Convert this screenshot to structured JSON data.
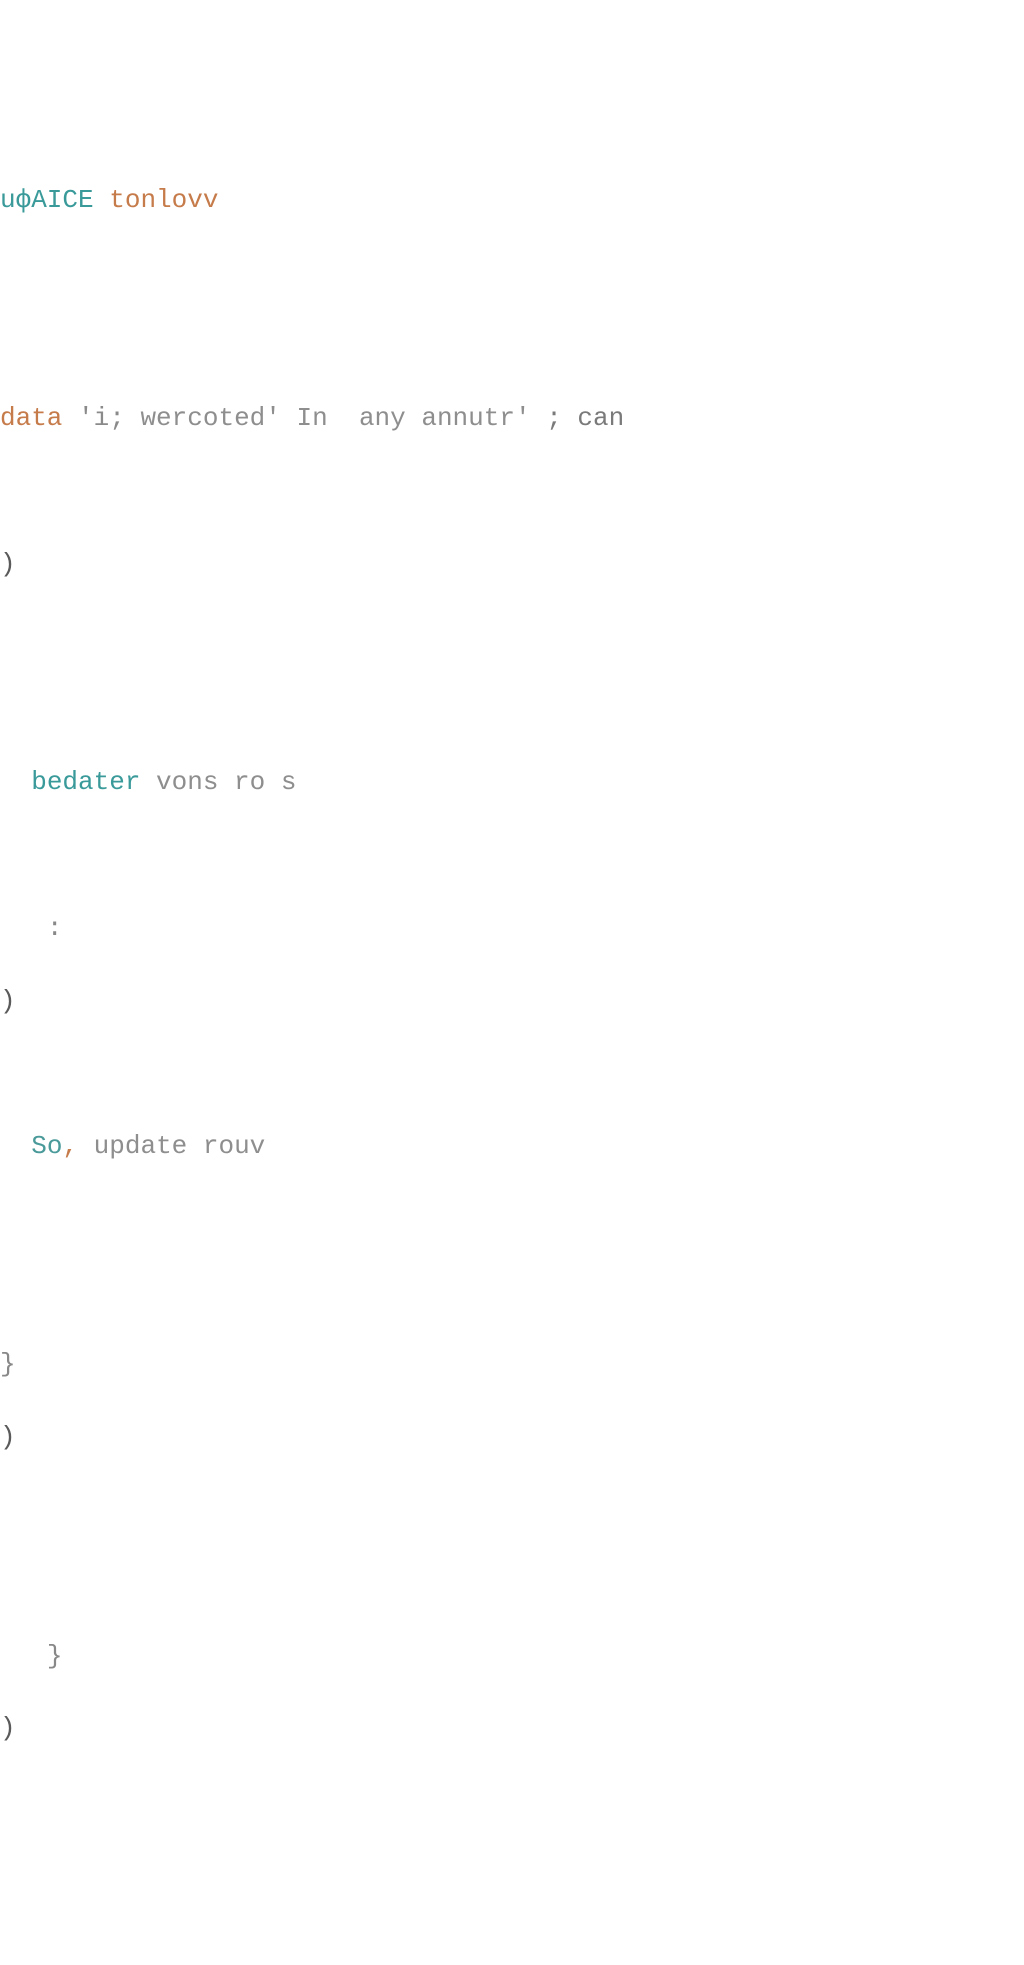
{
  "code": {
    "line1": {
      "kw1": "uфAICE",
      "kw2": "tonlovv"
    },
    "line2": {
      "kw": "data",
      "str1": "'i;",
      "str2": "wercoted'",
      "str3": "In",
      "txt1": "any annutr'",
      "txt2": ";",
      "txt3": "can"
    },
    "line3": {
      "paren": ")"
    },
    "line4": {
      "kw": "bedater",
      "txt": "vons ro s"
    },
    "line5": {
      "dots": ":"
    },
    "line6": {
      "paren": ")"
    },
    "line7": {
      "kw": "So",
      "comma": ",",
      "txt": "update rouv"
    },
    "line8": {
      "brace": "}"
    },
    "line9": {
      "paren": ")"
    },
    "line10": {
      "brace": "}"
    },
    "line11": {
      "paren": ")"
    }
  }
}
